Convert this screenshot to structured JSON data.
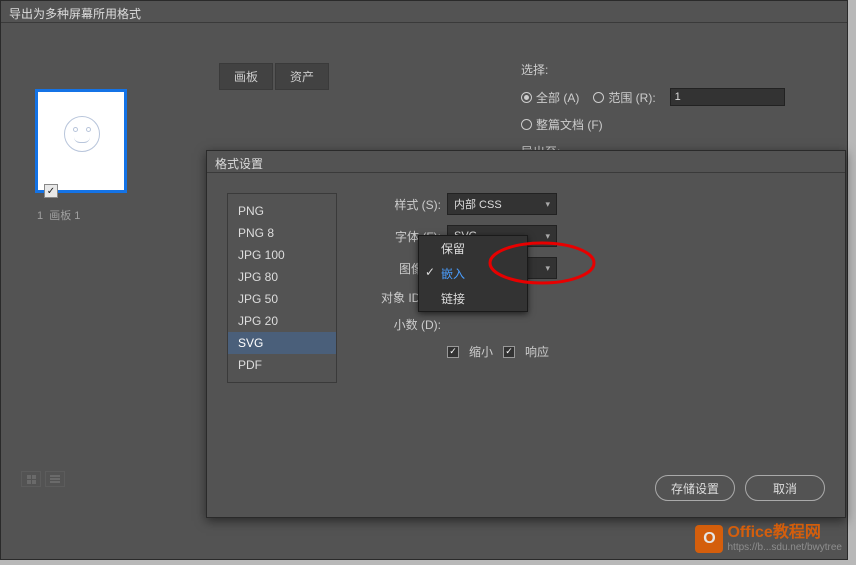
{
  "main_dialog": {
    "title": "导出为多种屏幕所用格式"
  },
  "tabs": {
    "artboard": "画板",
    "assets": "资产"
  },
  "artboard": {
    "index": "1",
    "name": "画板 1"
  },
  "right": {
    "select_label": "选择:",
    "all": "全部 (A)",
    "range": "范围 (R):",
    "range_value": "1",
    "full_doc": "整篇文档 (F)",
    "export_to": "导出至:"
  },
  "format_dialog": {
    "title": "格式设置"
  },
  "format_list": [
    "PNG",
    "PNG 8",
    "JPG 100",
    "JPG 80",
    "JPG 50",
    "JPG 20",
    "SVG",
    "PDF"
  ],
  "settings": {
    "style_label": "样式 (S):",
    "style_value": "内部 CSS",
    "font_label": "字体 (F):",
    "font_value": "SVG",
    "image_label": "图像 (I):",
    "image_value": "嵌入",
    "objectid_label": "对象 ID(O):",
    "decimal_label": "小数 (D):",
    "minify": "缩小",
    "responsive": "响应"
  },
  "dropdown": {
    "keep": "保留",
    "embed": "嵌入",
    "link": "链接"
  },
  "buttons": {
    "save": "存储设置",
    "cancel": "取消"
  },
  "watermark": {
    "brand": "Office教程网",
    "url": "https://b...sdu.net/bwytree"
  }
}
